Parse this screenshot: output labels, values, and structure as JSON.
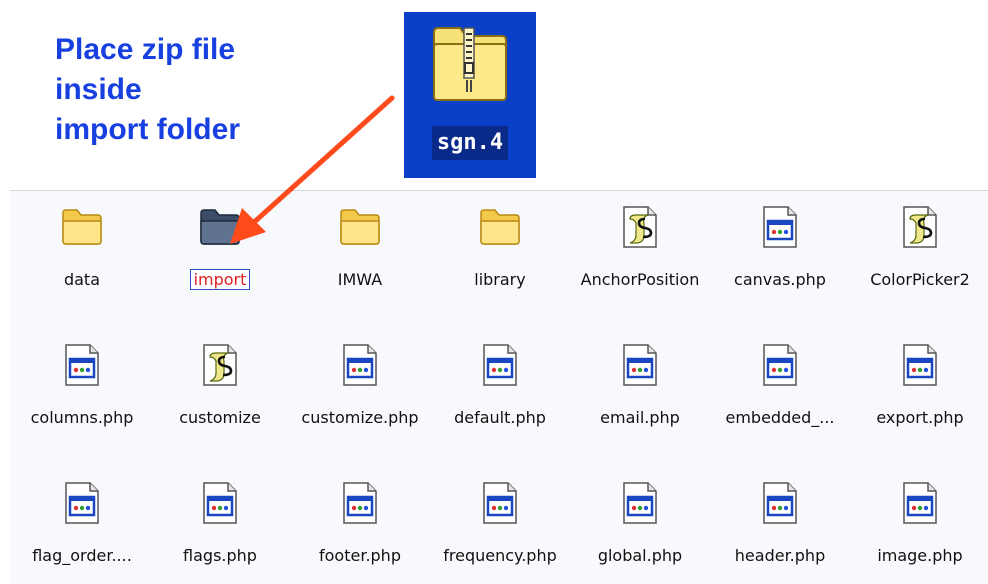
{
  "instruction": {
    "lines": [
      "Place zip file",
      "inside",
      "import folder"
    ]
  },
  "dragged_file": {
    "label": "sgn.4",
    "icon": "zip-folder-icon"
  },
  "colors": {
    "instruction_text": "#1840e0",
    "drag_tile_bg": "#0a3fc8",
    "arrow": "#ff4a1c",
    "selected_label": "#e02020"
  },
  "files": [
    {
      "label": "data",
      "icon": "folder-icon"
    },
    {
      "label": "import",
      "icon": "folder-icon",
      "selected": true
    },
    {
      "label": "IMWA",
      "icon": "folder-icon"
    },
    {
      "label": "library",
      "icon": "folder-icon"
    },
    {
      "label": "AnchorPosition",
      "icon": "script-icon"
    },
    {
      "label": "canvas.php",
      "icon": "php-file-icon"
    },
    {
      "label": "ColorPicker2",
      "icon": "script-icon"
    },
    {
      "label": "columns.php",
      "icon": "php-file-icon"
    },
    {
      "label": "customize",
      "icon": "script-icon"
    },
    {
      "label": "customize.php",
      "icon": "php-file-icon"
    },
    {
      "label": "default.php",
      "icon": "php-file-icon"
    },
    {
      "label": "email.php",
      "icon": "php-file-icon"
    },
    {
      "label": "embedded_...",
      "icon": "php-file-icon"
    },
    {
      "label": "export.php",
      "icon": "php-file-icon"
    },
    {
      "label": "flag_order....",
      "icon": "php-file-icon"
    },
    {
      "label": "flags.php",
      "icon": "php-file-icon"
    },
    {
      "label": "footer.php",
      "icon": "php-file-icon"
    },
    {
      "label": "frequency.php",
      "icon": "php-file-icon"
    },
    {
      "label": "global.php",
      "icon": "php-file-icon"
    },
    {
      "label": "header.php",
      "icon": "php-file-icon"
    },
    {
      "label": "image.php",
      "icon": "php-file-icon"
    }
  ]
}
